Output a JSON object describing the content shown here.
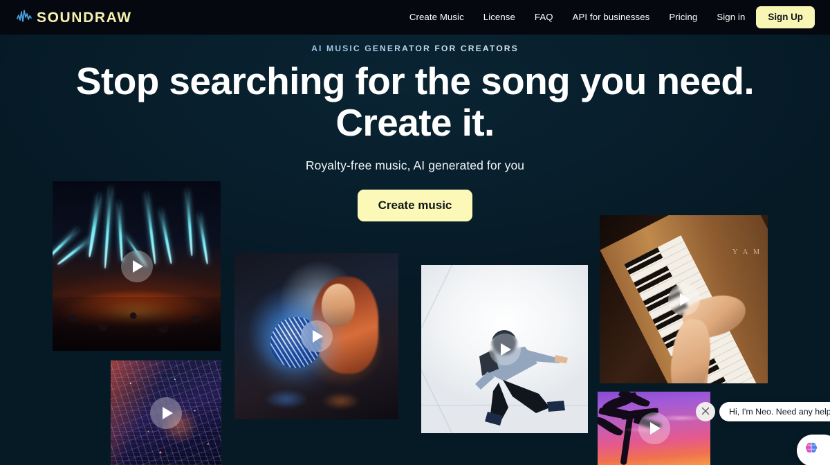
{
  "brand": {
    "name": "SOUNDRAW",
    "logo_icon": "waveform-icon",
    "logo_color": "#f6f1b0",
    "wave_color": "#4aa3e0"
  },
  "nav": {
    "links": [
      {
        "label": "Create Music"
      },
      {
        "label": "License"
      },
      {
        "label": "FAQ"
      },
      {
        "label": "API for businesses"
      },
      {
        "label": "Pricing"
      },
      {
        "label": "Sign in"
      }
    ],
    "signup_label": "Sign Up",
    "signup_bg": "#f8f6b4"
  },
  "hero": {
    "eyebrow": "AI MUSIC GENERATOR FOR CREATORS",
    "headline_line1": "Stop searching for the song you need.",
    "headline_line2": "Create it.",
    "subhead": "Royalty-free music, AI generated for you",
    "cta_label": "Create music",
    "cta_bg": "#fbf8b8"
  },
  "theme": {
    "page_bg": "#061a26",
    "header_bg": "#05080f",
    "accent": "#f8f6b4",
    "text": "#ffffff"
  },
  "gallery": {
    "play_icon": "play-icon",
    "cards": [
      {
        "id": "concert",
        "name": "concert-lasers",
        "alt": "Concert stage with cyan laser beams over a crowd"
      },
      {
        "id": "city",
        "name": "night-city",
        "alt": "Neon cyberpunk cityscape at night"
      },
      {
        "id": "disco",
        "name": "disco-ball-woman",
        "alt": "Woman holding a glowing disco ball"
      },
      {
        "id": "dancer",
        "name": "breakdancer",
        "alt": "Breakdancer mid-move on a white background"
      },
      {
        "id": "piano",
        "name": "piano-hands",
        "alt": "Hands playing a wooden upright piano"
      },
      {
        "id": "tropic",
        "name": "tropical-sunset",
        "alt": "Palm trees against a purple and pink sunset"
      }
    ],
    "piano_brand_mark": "Y A M"
  },
  "chat": {
    "message": "Hi, I'm Neo. Need any help?",
    "close_icon": "close-icon",
    "avatar_icon": "brain-icon"
  }
}
